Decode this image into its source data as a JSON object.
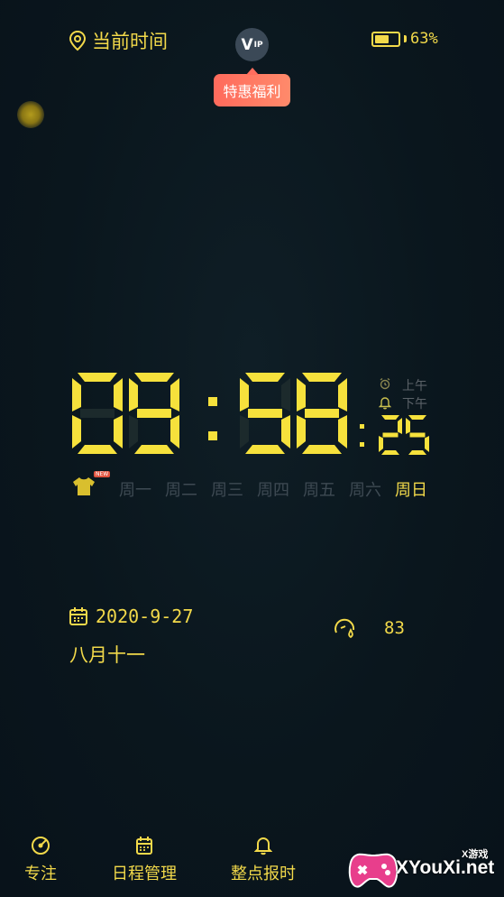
{
  "header": {
    "location_label": "当前时间",
    "vip_label": "V",
    "vip_sub": "IP",
    "promo_label": "特惠福利",
    "battery_percent_text": "63%",
    "battery_level": 0.63
  },
  "clock": {
    "hours": "09",
    "minutes": "58",
    "seconds": "25",
    "am_label": "上午",
    "pm_label": "下午",
    "ghost_hours": "88",
    "ghost_minutes": "88",
    "colors": {
      "lit": "#f6e13c",
      "ghost": "#1c2a2c"
    }
  },
  "week": {
    "shirt_tag": "NEW",
    "days": [
      {
        "label": "周一",
        "active": false
      },
      {
        "label": "周二",
        "active": false
      },
      {
        "label": "周三",
        "active": false
      },
      {
        "label": "周四",
        "active": false
      },
      {
        "label": "周五",
        "active": false
      },
      {
        "label": "周六",
        "active": false
      },
      {
        "label": "周日",
        "active": true
      }
    ]
  },
  "info": {
    "date": "2020-9-27",
    "lunar_date": "八月十一",
    "aqi_value": "83"
  },
  "nav": {
    "items": [
      {
        "label": "专注",
        "icon": "target-icon"
      },
      {
        "label": "日程管理",
        "icon": "calendar-icon"
      },
      {
        "label": "整点报时",
        "icon": "bell-icon"
      }
    ]
  },
  "watermark": {
    "text": "XYouXi.net",
    "top_text": "X游戏"
  },
  "theme": {
    "accent": "#f2d94a",
    "background": "#0b1720",
    "promo": "#ff6a5c"
  }
}
